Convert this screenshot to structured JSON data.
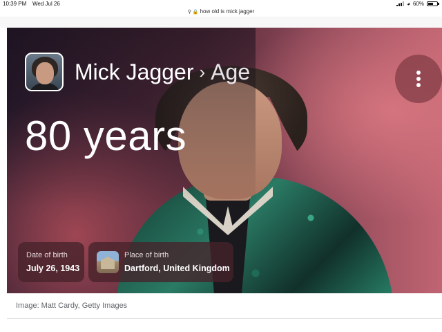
{
  "status_bar": {
    "time": "10:39 PM",
    "date": "Wed Jul 26",
    "battery": "60%",
    "battery_level": 0.6
  },
  "url_bar": {
    "text": "how old is mick jagger"
  },
  "card": {
    "name": "Mick Jagger",
    "separator": "›",
    "attribute": "Age",
    "age": "80 years",
    "date_of_birth": {
      "label": "Date of birth",
      "value": "July 26, 1943"
    },
    "place_of_birth": {
      "label": "Place of birth",
      "value": "Dartford, United Kingdom"
    }
  },
  "image_credit": "Image: Matt Cardy, Getty Images"
}
